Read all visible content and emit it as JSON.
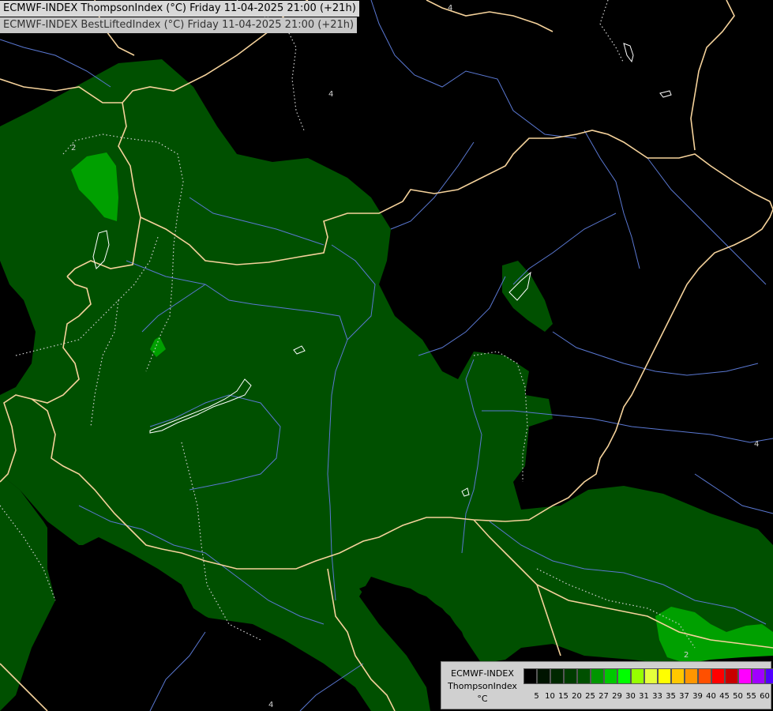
{
  "titles": {
    "line1": "ECMWF-INDEX ThompsonIndex (°C) Friday 11-04-2025 21:00 (+21h)",
    "line2": "ECMWF-INDEX BestLiftedIndex (°C) Friday 11-04-2025 21:00 (+21h)"
  },
  "legend": {
    "line1": "ECMWF-INDEX",
    "line2": "ThompsonIndex",
    "unit": "°C",
    "ticks": [
      "5",
      "10",
      "15",
      "20",
      "25",
      "27",
      "29",
      "30",
      "31",
      "33",
      "35",
      "37",
      "39",
      "40",
      "45",
      "50",
      "55",
      "60"
    ],
    "colors": [
      "#000000",
      "#001400",
      "#002800",
      "#003c00",
      "#005000",
      "#009600",
      "#00c800",
      "#00ff00",
      "#96ff00",
      "#e6ff3c",
      "#ffff00",
      "#ffc800",
      "#ff9600",
      "#ff5000",
      "#ff0000",
      "#c80000",
      "#ff00ff",
      "#a000ff",
      "#5000ff",
      "#0000ff"
    ]
  },
  "map": {
    "colors": {
      "background": "#000000",
      "field_dark_green": "#005000",
      "field_mid_green": "#00a000",
      "field_light_green": "#00c800",
      "borders": "#f5d29b",
      "rivers": "#5a78d2",
      "contours": "#d2d2d2"
    },
    "contour_labels": [
      "2",
      "4",
      "4",
      "4",
      "4",
      "2"
    ]
  }
}
